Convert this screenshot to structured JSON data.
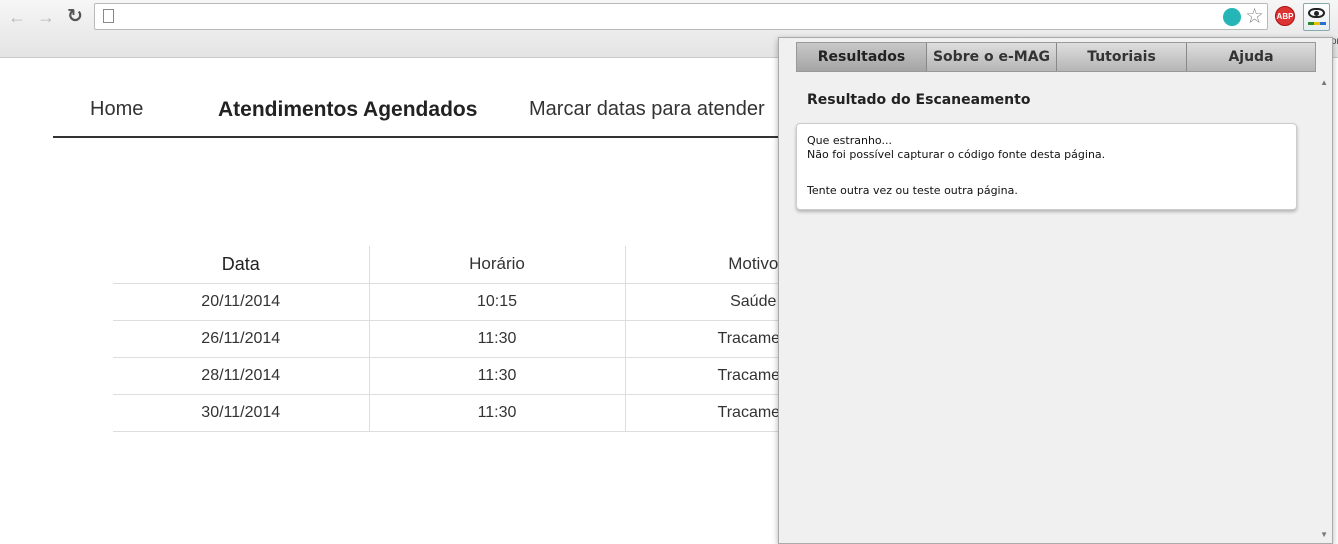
{
  "browser": {
    "address": "",
    "extensions": {
      "adblock_label": "ABP"
    },
    "overflow_label": "or"
  },
  "site_nav": {
    "items": [
      "Home",
      "Atendimentos Agendados",
      "Marcar datas para atender"
    ]
  },
  "table": {
    "headers": [
      "Data",
      "Horário",
      "Motivo"
    ],
    "rows": [
      [
        "20/11/2014",
        "10:15",
        "Saúde"
      ],
      [
        "26/11/2014",
        "11:30",
        "Tracamen"
      ],
      [
        "28/11/2014",
        "11:30",
        "Tracamen"
      ],
      [
        "30/11/2014",
        "11:30",
        "Tracamen"
      ]
    ]
  },
  "popup": {
    "tabs": [
      "Resultados",
      "Sobre o e-MAG",
      "Tutoriais",
      "Ajuda"
    ],
    "active_tab": "Resultados",
    "heading": "Resultado do Escaneamento",
    "message": {
      "line1": "Que estranho...",
      "line2": "Não foi possível capturar o código fonte desta página.",
      "line3": "Tente outra vez ou teste outra página."
    }
  },
  "colors": {
    "accent_teal": "#26b5b6",
    "abp_red": "#dd3333"
  }
}
